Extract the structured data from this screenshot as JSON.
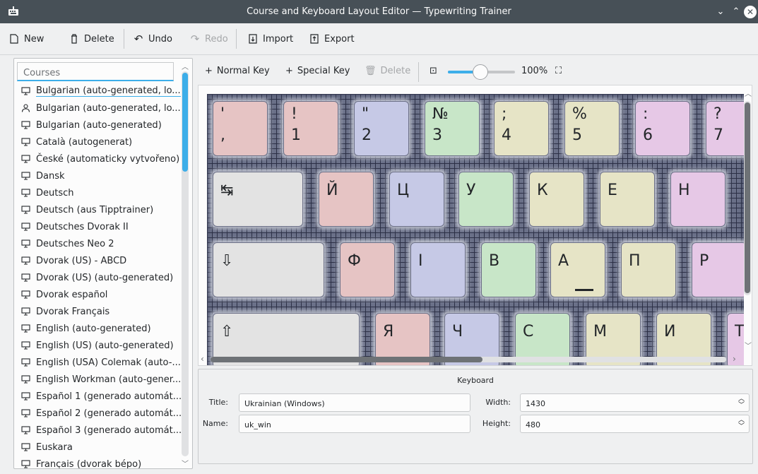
{
  "window": {
    "title": "Course and Keyboard Layout Editor — Typewriting Trainer"
  },
  "toolbar": {
    "new_label": "New",
    "delete_label": "Delete",
    "undo_label": "Undo",
    "redo_label": "Redo",
    "import_label": "Import",
    "export_label": "Export"
  },
  "courses": {
    "header": "Courses",
    "items": [
      {
        "label": "Bulgarian (auto-generated, lo...",
        "icon": "keyboard-icon"
      },
      {
        "label": "Bulgarian (auto-generated, lo...",
        "icon": "user-icon"
      },
      {
        "label": "Bulgarian (auto-generated)",
        "icon": "keyboard-icon"
      },
      {
        "label": "Català (autogenerat)",
        "icon": "keyboard-icon"
      },
      {
        "label": "České (automaticky vytvořeno)",
        "icon": "keyboard-icon"
      },
      {
        "label": "Dansk",
        "icon": "keyboard-icon"
      },
      {
        "label": "Deutsch",
        "icon": "keyboard-icon"
      },
      {
        "label": "Deutsch (aus Tipptrainer)",
        "icon": "keyboard-icon"
      },
      {
        "label": "Deutsches Dvorak II",
        "icon": "keyboard-icon"
      },
      {
        "label": "Deutsches Neo 2",
        "icon": "keyboard-icon"
      },
      {
        "label": "Dvorak (US) - ABCD",
        "icon": "keyboard-icon"
      },
      {
        "label": "Dvorak (US) (auto-generated)",
        "icon": "keyboard-icon"
      },
      {
        "label": "Dvorak español",
        "icon": "keyboard-icon"
      },
      {
        "label": "Dvorak Français",
        "icon": "keyboard-icon"
      },
      {
        "label": "English (auto-generated)",
        "icon": "keyboard-icon"
      },
      {
        "label": "English (US) (auto-generated)",
        "icon": "keyboard-icon"
      },
      {
        "label": "English (USA) Colemak (auto-...",
        "icon": "keyboard-icon"
      },
      {
        "label": "English Workman (auto-gener...",
        "icon": "keyboard-icon"
      },
      {
        "label": "Español 1 (generado automát...",
        "icon": "keyboard-icon"
      },
      {
        "label": "Español 2 (generado automát...",
        "icon": "keyboard-icon"
      },
      {
        "label": "Español 3 (generado automát...",
        "icon": "keyboard-icon"
      },
      {
        "label": "Euskara",
        "icon": "keyboard-icon"
      },
      {
        "label": "Français (dvorak bépo)",
        "icon": "keyboard-icon"
      }
    ]
  },
  "editor_toolbar": {
    "normal_key_label": "Normal Key",
    "special_key_label": "Special Key",
    "delete_label": "Delete",
    "zoom_value": "100%",
    "zoom_fraction": 0.48
  },
  "keys": [
    {
      "top": "'",
      "bottom": ",",
      "color": "#e6c4c4"
    },
    {
      "top": "!",
      "bottom": "1",
      "color": "#e6c4c4"
    },
    {
      "top": "\"",
      "bottom": "2",
      "color": "#c6c9e6"
    },
    {
      "top": "№",
      "bottom": "3",
      "color": "#c8e6c8"
    },
    {
      "top": ";",
      "bottom": "4",
      "color": "#e6e4c6"
    },
    {
      "top": "%",
      "bottom": "5",
      "color": "#e6e4c6"
    },
    {
      "top": ":",
      "bottom": "6",
      "color": "#e6c8e6"
    },
    {
      "top": "?",
      "bottom": "7",
      "color": "#e6c8e6"
    },
    {
      "label": "↹",
      "color": "#e3e3e3"
    },
    {
      "label": "Й",
      "color": "#e6c4c4"
    },
    {
      "label": "Ц",
      "color": "#c6c9e6"
    },
    {
      "label": "У",
      "color": "#c8e6c8"
    },
    {
      "label": "К",
      "color": "#e6e4c6"
    },
    {
      "label": "Е",
      "color": "#e6e4c6"
    },
    {
      "label": "Н",
      "color": "#e6c8e6"
    },
    {
      "label": "⇩",
      "color": "#e3e3e3"
    },
    {
      "label": "Ф",
      "color": "#e6c4c4"
    },
    {
      "label": "І",
      "color": "#c6c9e6"
    },
    {
      "label": "В",
      "color": "#c8e6c8"
    },
    {
      "label": "А",
      "color": "#e6e4c6"
    },
    {
      "label": "П",
      "color": "#e6e4c6"
    },
    {
      "label": "Р",
      "color": "#e6c8e6"
    },
    {
      "label": "⇧",
      "color": "#e3e3e3"
    },
    {
      "label": "Я",
      "color": "#e6c4c4"
    },
    {
      "label": "Ч",
      "color": "#c6c9e6"
    },
    {
      "label": "С",
      "color": "#c8e6c8"
    },
    {
      "label": "М",
      "color": "#e6e4c6"
    },
    {
      "label": "И",
      "color": "#e6e4c6"
    },
    {
      "label": "Т",
      "color": "#e6c8e6"
    }
  ],
  "keyboard_props": {
    "section_title": "Keyboard",
    "title_label": "Title:",
    "title_value": "Ukrainian (Windows)",
    "name_label": "Name:",
    "name_value": "uk_win",
    "width_label": "Width:",
    "width_value": "1430",
    "height_label": "Height:",
    "height_value": "480"
  }
}
